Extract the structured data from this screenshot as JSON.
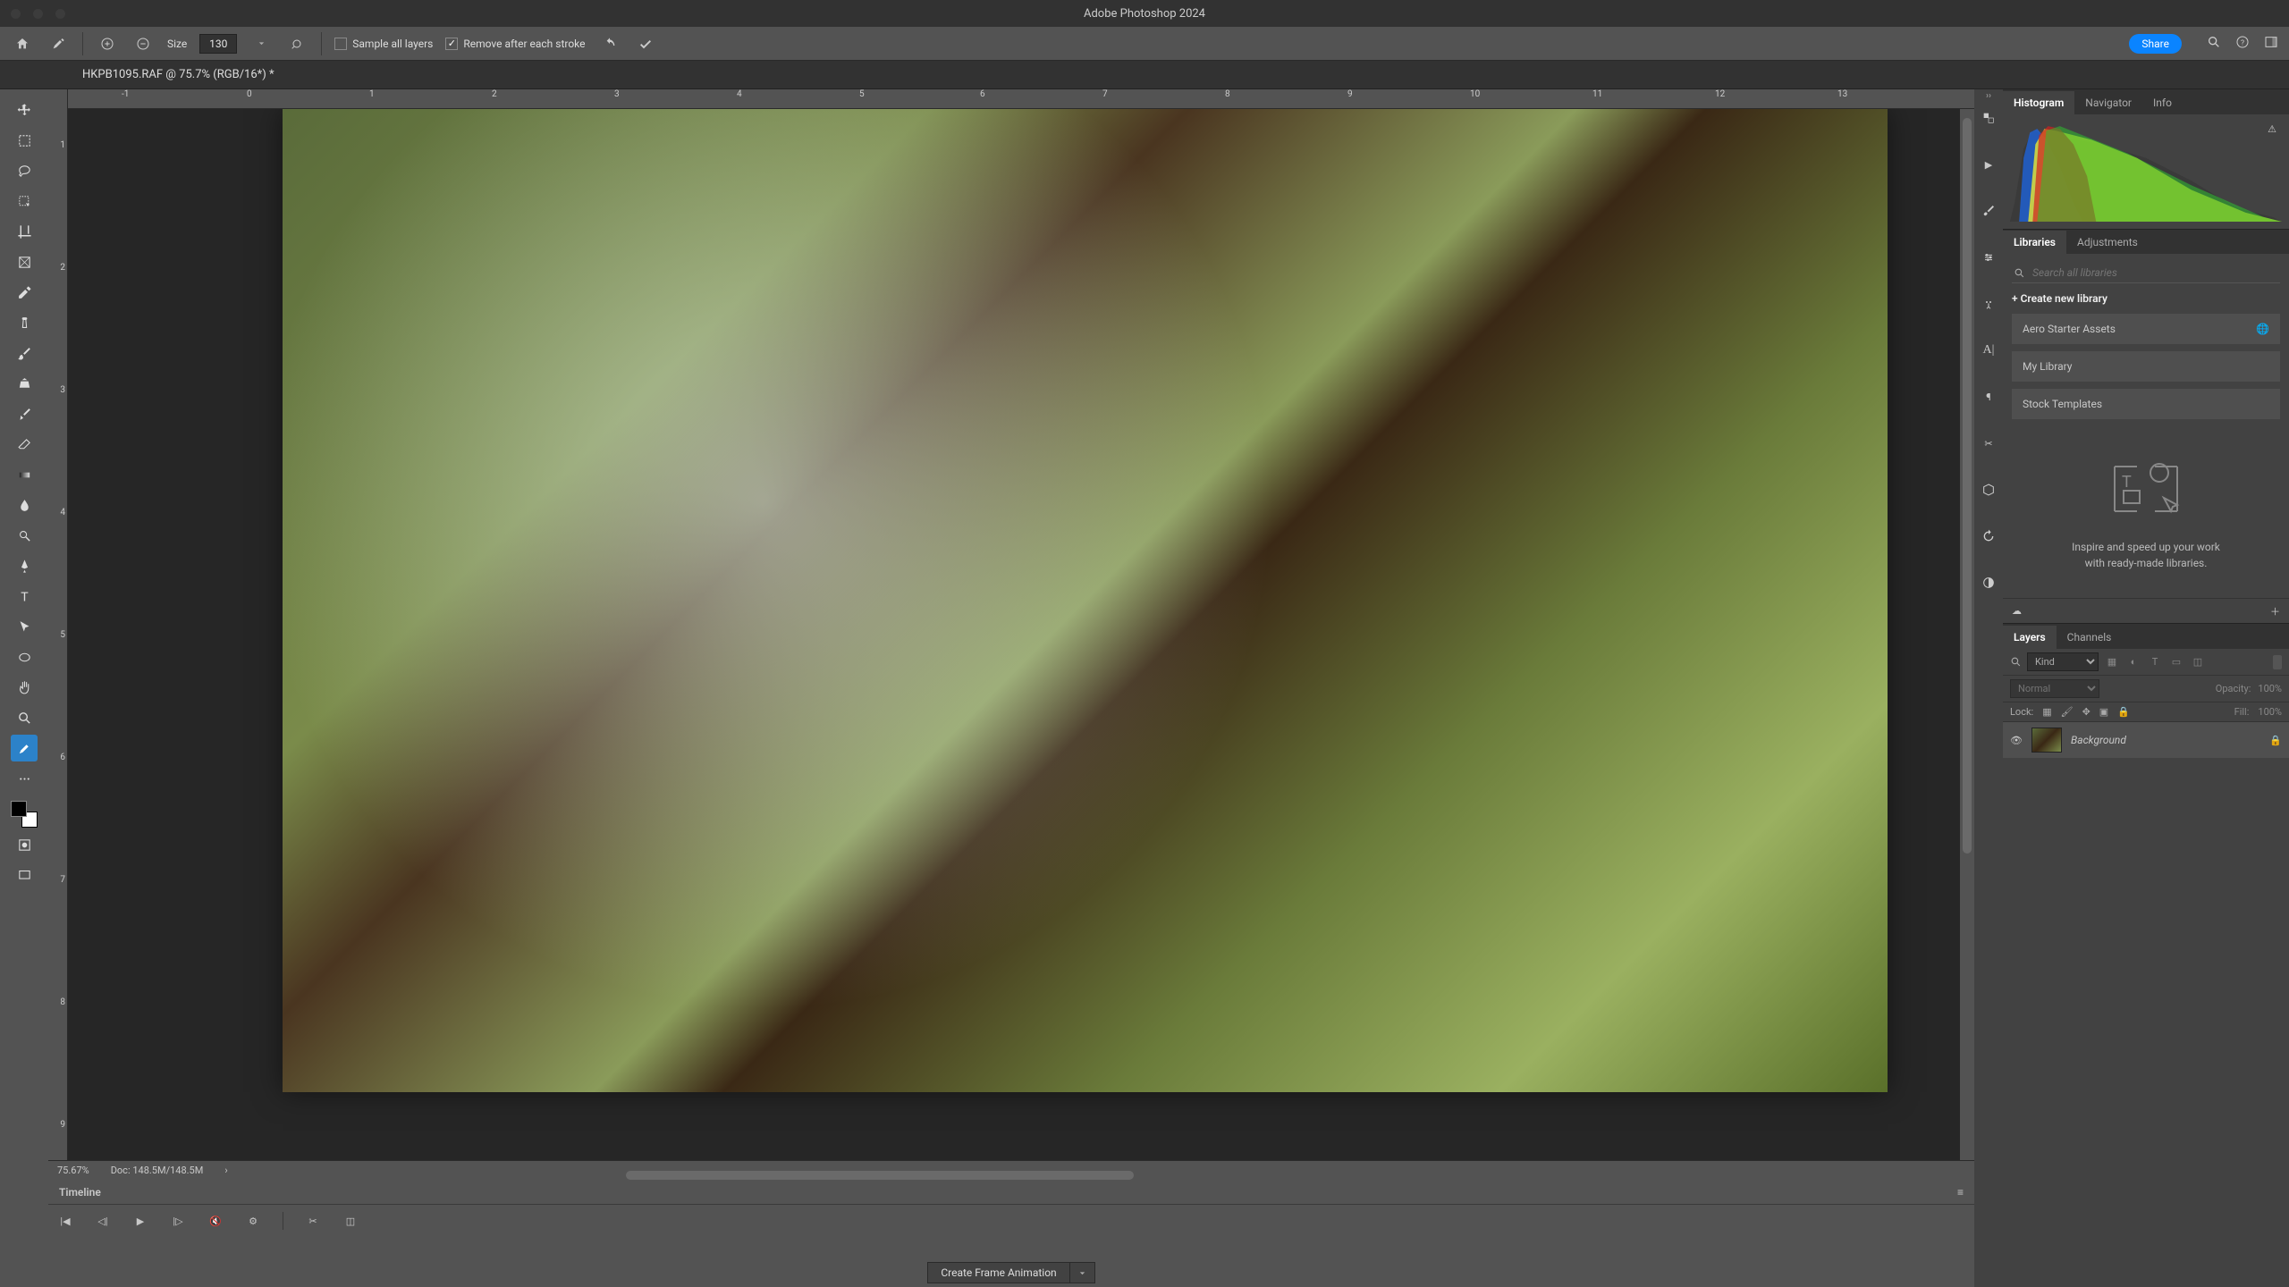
{
  "app_title": "Adobe Photoshop 2024",
  "options": {
    "size_label": "Size",
    "size_value": "130",
    "sample_all": "Sample all layers",
    "remove_after": "Remove after each stroke",
    "share": "Share"
  },
  "doc_tab": "HKPB1095.RAF @ 75.7% (RGB/16*) *",
  "ruler_h": [
    "-1",
    "0",
    "1",
    "2",
    "3",
    "4",
    "5",
    "6",
    "7",
    "8",
    "9",
    "10",
    "11",
    "12",
    "13"
  ],
  "ruler_v": [
    "1",
    "2",
    "3",
    "4",
    "5",
    "6",
    "7",
    "8",
    "9"
  ],
  "status": {
    "zoom": "75.67%",
    "doc": "Doc: 148.5M/148.5M"
  },
  "timeline": {
    "title": "Timeline",
    "create": "Create Frame Animation"
  },
  "panels": {
    "hist_tabs": [
      "Histogram",
      "Navigator",
      "Info"
    ],
    "lib_tabs": [
      "Libraries",
      "Adjustments"
    ],
    "search_placeholder": "Search all libraries",
    "create_lib": "+  Create new library",
    "libs": [
      "Aero Starter Assets",
      "My Library",
      "Stock Templates"
    ],
    "inspire1": "Inspire and speed up your work",
    "inspire2": "with ready-made libraries.",
    "layer_tabs": [
      "Layers",
      "Channels"
    ],
    "kind": "Kind",
    "blend": "Normal",
    "opacity_label": "Opacity:",
    "opacity_val": "100%",
    "lock_label": "Lock:",
    "fill_label": "Fill:",
    "fill_val": "100%",
    "bg_layer": "Background"
  }
}
